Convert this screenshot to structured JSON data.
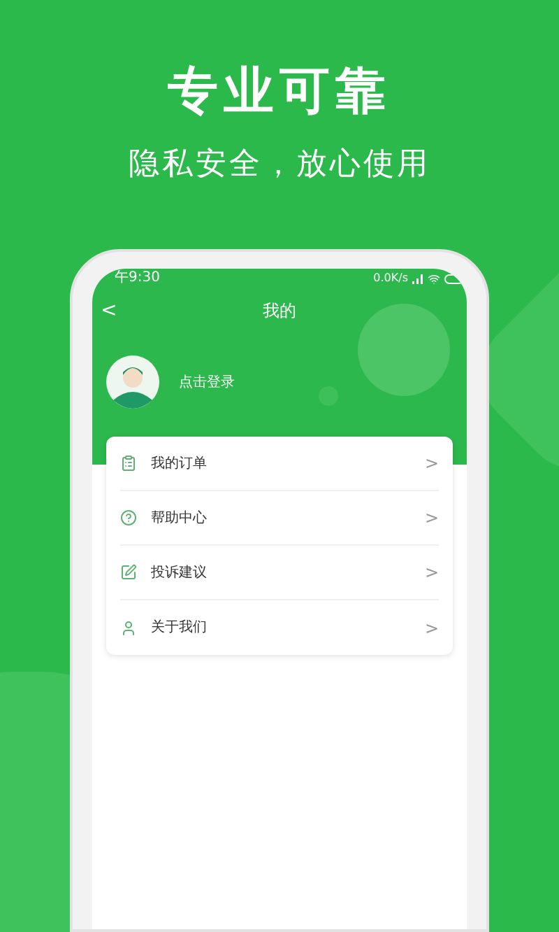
{
  "headline": "专业可靠",
  "subheadline": "隐私安全，放心使用",
  "status_bar": {
    "time": "午9:30",
    "speed": "0.0K/s"
  },
  "app_bar": {
    "back": "<",
    "title": "我的"
  },
  "profile": {
    "login": "点击登录"
  },
  "menu": [
    {
      "label": "我的订单",
      "chevron": ">"
    },
    {
      "label": "帮助中心",
      "chevron": ">"
    },
    {
      "label": "投诉建议",
      "chevron": ">"
    },
    {
      "label": "关于我们",
      "chevron": ">"
    }
  ]
}
